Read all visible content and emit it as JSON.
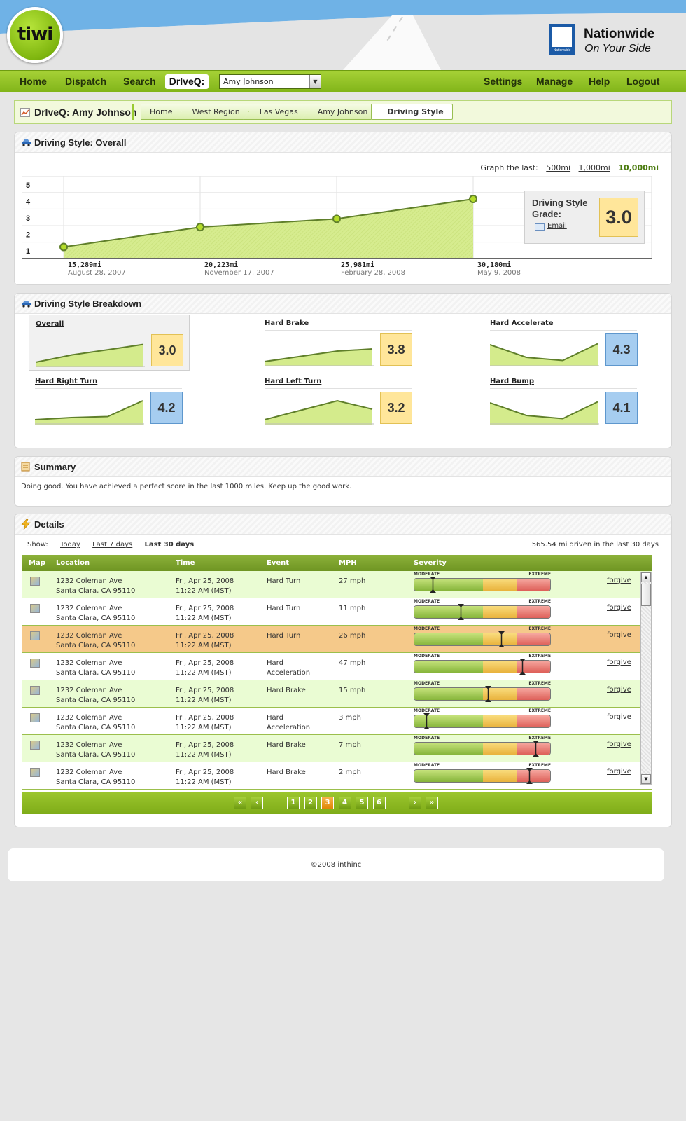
{
  "header": {
    "logo_text": "tiwi",
    "partner_name": "Nationwide",
    "partner_tagline": "On Your Side",
    "partner_mark_text": "Nationwide"
  },
  "nav": {
    "left": [
      "Home",
      "Dispatch",
      "Search"
    ],
    "driveq_label": "DrIveQ:",
    "driver_select": "Amy Johnson",
    "right": [
      "Settings",
      "Manage",
      "Help",
      "Logout"
    ]
  },
  "breadcrumb": {
    "title": "DrIveQ: Amy Johnson",
    "items": [
      "Home",
      "West Region",
      "Las Vegas",
      "Amy Johnson",
      "Driving Style"
    ]
  },
  "overall": {
    "heading": "Driving Style: Overall",
    "graph_label": "Graph the last:",
    "graph_options": [
      "500mi",
      "1,000mi",
      "10,000mi"
    ],
    "active_option": "10,000mi",
    "grade_label": "Driving Style Grade:",
    "grade_value": "3.0",
    "email_label": "Email"
  },
  "chart_data": {
    "type": "area",
    "x": [
      "15,289mi",
      "20,223mi",
      "25,981mi",
      "30,180mi"
    ],
    "x_dates": [
      "August 28, 2007",
      "November 17, 2007",
      "February 28, 2008",
      "May 9, 2008"
    ],
    "values": [
      1.2,
      2.4,
      2.9,
      4.1
    ],
    "yticks": [
      "1",
      "2",
      "3",
      "4",
      "5"
    ],
    "ylim": [
      0.5,
      5.5
    ],
    "grid": true
  },
  "breakdown": {
    "heading": "Driving Style Breakdown",
    "items": [
      {
        "title": "Overall",
        "score": "3.0",
        "color": "yellow",
        "trend": [
          0.1,
          0.45,
          0.7,
          0.95
        ]
      },
      {
        "title": "Hard Brake",
        "score": "3.8",
        "color": "yellow",
        "trend": [
          0.1,
          0.35,
          0.6,
          0.7
        ]
      },
      {
        "title": "Hard Accelerate",
        "score": "4.3",
        "color": "blue",
        "trend": [
          0.9,
          0.3,
          0.15,
          0.95
        ]
      },
      {
        "title": "Hard Right Turn",
        "score": "4.2",
        "color": "blue",
        "trend": [
          0.1,
          0.2,
          0.25,
          1.0
        ]
      },
      {
        "title": "Hard Left Turn",
        "score": "3.2",
        "color": "yellow",
        "trend": [
          0.1,
          0.55,
          1.0,
          0.6
        ]
      },
      {
        "title": "Hard Bump",
        "score": "4.1",
        "color": "blue",
        "trend": [
          0.9,
          0.3,
          0.15,
          0.95
        ]
      }
    ]
  },
  "summary": {
    "heading": "Summary",
    "text": "Doing good.  You have achieved a perfect score in the last 1000 miles.  Keep up the good work."
  },
  "details": {
    "heading": "Details",
    "show_label": "Show:",
    "show_options": [
      "Today",
      "Last 7 days",
      "Last 30 days"
    ],
    "active_show": "Last 30 days",
    "driven_text": "565.54 mi driven in the last 30 days",
    "columns": [
      "Map",
      "Location",
      "Time",
      "Event",
      "MPH",
      "Severity"
    ],
    "severity_labels": [
      "MODERATE",
      "EXTREME"
    ],
    "forgive_label": "forgive",
    "rows": [
      {
        "loc1": "1232 Coleman Ave",
        "loc2": "Santa Clara, CA 95110",
        "t1": "Fri, Apr 25, 2008",
        "t2": "11:22 AM (MST)",
        "ev1": "Hard Turn",
        "ev2": "",
        "mph": "27 mph",
        "severity": 0.14,
        "style": "alt"
      },
      {
        "loc1": "1232 Coleman Ave",
        "loc2": "Santa Clara, CA 95110",
        "t1": "Fri, Apr 25, 2008",
        "t2": "11:22 AM (MST)",
        "ev1": "Hard Turn",
        "ev2": "",
        "mph": "11 mph",
        "severity": 0.34,
        "style": ""
      },
      {
        "loc1": "1232 Coleman Ave",
        "loc2": "Santa Clara, CA 95110",
        "t1": "Fri, Apr 25, 2008",
        "t2": "11:22 AM (MST)",
        "ev1": "Hard Turn",
        "ev2": "",
        "mph": "26 mph",
        "severity": 0.64,
        "style": "hl"
      },
      {
        "loc1": "1232 Coleman Ave",
        "loc2": "Santa Clara, CA 95110",
        "t1": "Fri, Apr 25, 2008",
        "t2": "11:22 AM (MST)",
        "ev1": "Hard",
        "ev2": "Acceleration",
        "mph": "47 mph",
        "severity": 0.79,
        "style": ""
      },
      {
        "loc1": "1232 Coleman Ave",
        "loc2": "Santa Clara, CA 95110",
        "t1": "Fri, Apr 25, 2008",
        "t2": "11:22 AM (MST)",
        "ev1": "Hard Brake",
        "ev2": "",
        "mph": "15 mph",
        "severity": 0.54,
        "style": "alt"
      },
      {
        "loc1": "1232 Coleman Ave",
        "loc2": "Santa Clara, CA 95110",
        "t1": "Fri, Apr 25, 2008",
        "t2": "11:22 AM (MST)",
        "ev1": "Hard",
        "ev2": "Acceleration",
        "mph": "3 mph",
        "severity": 0.09,
        "style": ""
      },
      {
        "loc1": "1232 Coleman Ave",
        "loc2": "Santa Clara, CA 95110",
        "t1": "Fri, Apr 25, 2008",
        "t2": "11:22 AM (MST)",
        "ev1": "Hard Brake",
        "ev2": "",
        "mph": "7 mph",
        "severity": 0.89,
        "style": "alt"
      },
      {
        "loc1": "1232 Coleman Ave",
        "loc2": "Santa Clara, CA 95110",
        "t1": "Fri, Apr 25, 2008",
        "t2": "11:22 AM (MST)",
        "ev1": "Hard Brake",
        "ev2": "",
        "mph": "2 mph",
        "severity": 0.84,
        "style": ""
      }
    ],
    "pages": [
      "1",
      "2",
      "3",
      "4",
      "5",
      "6"
    ],
    "current_page": "3"
  },
  "footer": {
    "text": "©2008 inthinc"
  },
  "colors": {
    "accent_green": "#82b51a",
    "grade_yellow": "#ffe69a",
    "grade_blue": "#a6cdf0",
    "highlight_row": "#f5c98a"
  }
}
